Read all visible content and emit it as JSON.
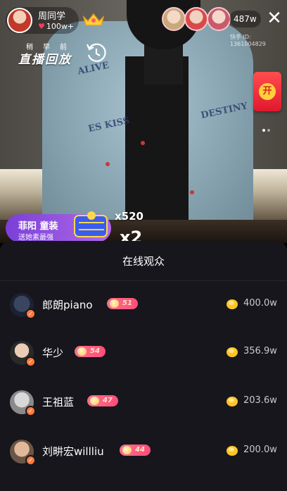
{
  "host": {
    "name": "周同学",
    "likes": "100w+"
  },
  "viewers": {
    "count": "487w"
  },
  "id_label": "快手 ID: 1361004829",
  "replay": {
    "top": "稍早前",
    "main": "直播回放"
  },
  "redpack": {
    "coin_text": "开"
  },
  "gift": {
    "user": "菲阳 童装",
    "text": "送她素最强",
    "count": "x520",
    "combo": "x2"
  },
  "sheet": {
    "title": "在线观众"
  },
  "audience": [
    {
      "name": "郎朗piano",
      "level": "51",
      "value": "400.0w"
    },
    {
      "name": "华少",
      "level": "54",
      "value": "356.9w"
    },
    {
      "name": "王祖蓝",
      "level": "47",
      "value": "203.6w"
    },
    {
      "name": "刘畊宏willliu",
      "level": "44",
      "value": "200.0w"
    }
  ],
  "colors": {
    "level_badge": "#ff5a82",
    "sheet_bg": "#16161c",
    "verified_badge": "#ff7a3d",
    "coin": "#ffc526"
  }
}
